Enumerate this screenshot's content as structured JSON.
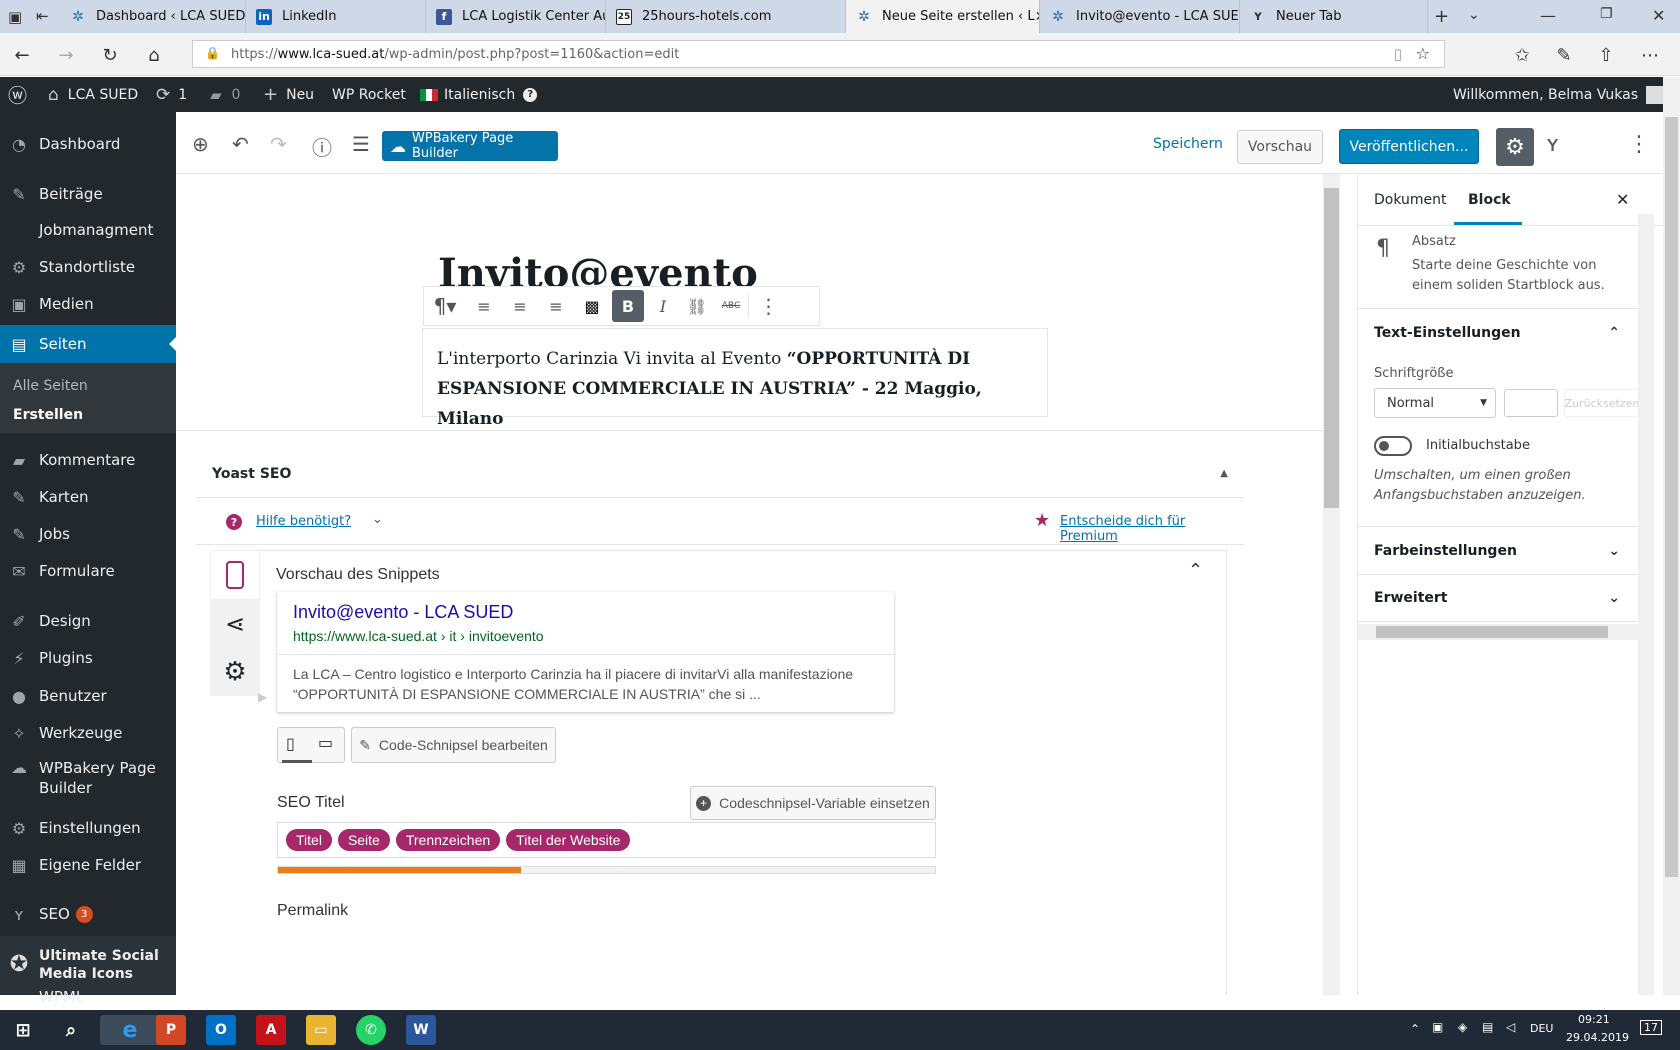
{
  "browser": {
    "tabs": [
      {
        "label": "Dashboard ‹ LCA SUED — '",
        "icon": "wordpress-icon",
        "color": "#2271b1"
      },
      {
        "label": "LinkedIn",
        "icon": "linkedin-icon",
        "color": "#0a66c2"
      },
      {
        "label": "LCA Logistik Center Austria",
        "icon": "facebook-icon",
        "color": "#3b5998"
      },
      {
        "label": "25hours-hotels.com",
        "icon": "hotel-icon",
        "color": "#222222"
      },
      {
        "label": "Neue Seite erstellen ‹ L",
        "icon": "wordpress-icon",
        "color": "#2271b1"
      },
      {
        "label": "Invito@evento - LCA SUED",
        "icon": "wordpress-icon",
        "color": "#2271b1"
      },
      {
        "label": "Neuer Tab",
        "icon": "yoast-icon",
        "color": "#333333"
      }
    ],
    "url_prefix": "https://",
    "url_domain": "www.lca-sued.at",
    "url_path": "/wp-admin/post.php?post=1160&action=edit"
  },
  "adminbar": {
    "site": "LCA SUED",
    "updates": "1",
    "comments": "0",
    "new": "Neu",
    "rocket": "WP Rocket",
    "language": "Italienisch",
    "greeting": "Willkommen, Belma Vukas"
  },
  "sidebar": {
    "items": [
      {
        "label": "Dashboard",
        "icon": "dashboard-icon"
      },
      {
        "label": "Beiträge",
        "icon": "pin-icon"
      },
      {
        "label": "Jobmanagment",
        "icon": ""
      },
      {
        "label": "Standortliste",
        "icon": "gear-icon"
      },
      {
        "label": "Medien",
        "icon": "media-icon"
      },
      {
        "label": "Seiten",
        "icon": "pages-icon"
      },
      {
        "label": "Kommentare",
        "icon": "comment-icon"
      },
      {
        "label": "Karten",
        "icon": "pin-icon"
      },
      {
        "label": "Jobs",
        "icon": "pin-icon"
      },
      {
        "label": "Formulare",
        "icon": "mail-icon"
      },
      {
        "label": "Design",
        "icon": "brush-icon"
      },
      {
        "label": "Plugins",
        "icon": "plugin-icon"
      },
      {
        "label": "Benutzer",
        "icon": "user-icon"
      },
      {
        "label": "Werkzeuge",
        "icon": "wrench-icon"
      },
      {
        "label": "WPBakery Page Builder",
        "icon": "cloud-icon"
      },
      {
        "label": "Einstellungen",
        "icon": "settings-icon"
      },
      {
        "label": "Eigene Felder",
        "icon": "grid-icon"
      },
      {
        "label": "SEO",
        "icon": "yoast-icon",
        "badge": "3"
      },
      {
        "label": "Ultimate Social Media Icons",
        "icon": "share-icon"
      },
      {
        "label": "WPML",
        "icon": ""
      }
    ],
    "sub": {
      "all": "Alle Seiten",
      "create": "Erstellen"
    }
  },
  "toolbar": {
    "wpbakery": "WPBakery Page Builder",
    "save": "Speichern",
    "preview": "Vorschau",
    "publish": "Veröffentlichen..."
  },
  "post": {
    "title": "Invito@evento",
    "para_plain": "L'interporto Carinzia Vi invita al Evento ",
    "para_bold": "“OPPORTUNITÀ DI ESPANSIONE COMMERCIALE IN AUSTRIA” - 22 Maggio, Milano"
  },
  "yoast": {
    "title": "Yoast SEO",
    "help": "Hilfe benötigt?",
    "premium": "Entscheide dich für Premium",
    "snippet_heading": "Vorschau des Snippets",
    "snippet_title": "Invito@evento - LCA SUED",
    "snippet_url": "https://www.lca-sued.at › it › invitoevento",
    "snippet_desc": "La LCA – Centro logistico e Interporto Carinzia ha il piacere di invitarVi alla manifestazione “OPPORTUNITÀ DI ESPANSIONE COMMERCIALE IN AUSTRIA” che si ...",
    "edit_snippet": "Code-Schnipsel bearbeiten",
    "seo_title_label": "SEO Titel",
    "insert_var": "Codeschnipsel-Variable einsetzen",
    "pills": [
      "Titel",
      "Seite",
      "Trennzeichen",
      "Titel der Website"
    ],
    "title_progress": 0.37,
    "permalink": "Permalink"
  },
  "panel": {
    "tab_doc": "Dokument",
    "tab_block": "Block",
    "block_name": "Absatz",
    "block_desc": "Starte deine Geschichte von einem soliden Startblock aus.",
    "text_settings": "Text-Einstellungen",
    "font_size_label": "Schriftgröße",
    "font_size_value": "Normal",
    "reset": "Zurücksetzen",
    "dropcap": "Initialbuchstabe",
    "dropcap_help": "Umschalten, um einen großen Anfangsbuchstaben anzuzeigen.",
    "colors": "Farbeinstellungen",
    "advanced": "Erweitert"
  },
  "taskbar": {
    "lang": "DEU",
    "time": "09:21",
    "date": "29.04.2019",
    "notif": "17"
  },
  "colors": {
    "wp_blue": "#0073aa",
    "yoast_purple": "#a4286a",
    "orange": "#ee7c1b"
  }
}
